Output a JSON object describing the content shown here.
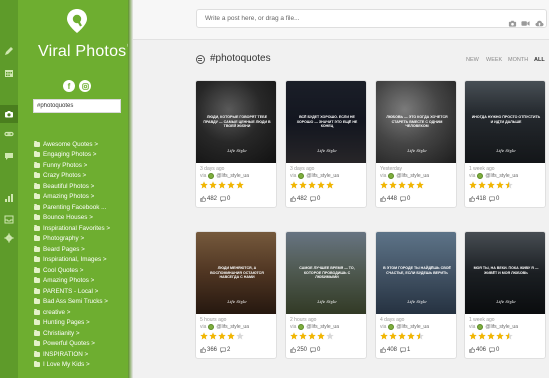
{
  "rail": {
    "icons": [
      "pencil-icon",
      "calendar-icon",
      "camera-icon",
      "link-icon",
      "comment-icon",
      "bar-chart-icon",
      "inbox-icon",
      "gear-icon"
    ]
  },
  "sidebar": {
    "title": "Viral Photos",
    "badge": "®",
    "search_value": "#photoquotes",
    "items": [
      {
        "label": "Awesome Quotes >"
      },
      {
        "label": "Engaging Photos >"
      },
      {
        "label": "Funny Photos >"
      },
      {
        "label": "Crazy Photos >"
      },
      {
        "label": "Beautiful Photos >"
      },
      {
        "label": "Amazing Photos >"
      },
      {
        "label": "Parenting Facebook ..."
      },
      {
        "label": "Bounce Houses >"
      },
      {
        "label": "Inspirational Favorites >"
      },
      {
        "label": "Photography >"
      },
      {
        "label": "Beard Pages >"
      },
      {
        "label": "Inspirational, Images >"
      },
      {
        "label": "Cool Quotes >"
      },
      {
        "label": "Amazing Photos >"
      },
      {
        "label": "PARENTS - Local >"
      },
      {
        "label": "Bad Ass Semi Trucks >"
      },
      {
        "label": "creative >"
      },
      {
        "label": "Hunting Pages >"
      },
      {
        "label": "Christianity >"
      },
      {
        "label": "Powerful Quotes >"
      },
      {
        "label": "INSPIRATION >"
      },
      {
        "label": "I Love My Kids >"
      }
    ]
  },
  "composer": {
    "placeholder": "Write a post here, or drag a file..."
  },
  "main": {
    "section_title": "#photoquotes",
    "filters": [
      "NEW",
      "WEEK",
      "MONTH",
      "ALL"
    ],
    "active_filter": "ALL",
    "cards": [
      {
        "time": "3 days ago",
        "via": "via",
        "user": "@lifs_style_ua",
        "rating": 5,
        "likes": "482",
        "comments": "0",
        "quote": "ЛЮДИ, КОТОРЫЕ ГОВОРЯТ ТЕБЕ ПРАВДУ — САМЫЕ ЦЕННЫЕ ЛЮДИ В ТВОЕЙ ЖИЗНИ",
        "signature": "Life Style"
      },
      {
        "time": "3 days ago",
        "via": "via",
        "user": "@lifs_style_ua",
        "rating": 5,
        "likes": "482",
        "comments": "0",
        "quote": "ВСЁ БУДЕТ ХОРОШО. ЕСЛИ НЕ ХОРОШО — ЗНАЧИТ ЭТО ЕЩЁ НЕ КОНЕЦ",
        "signature": "Life Style"
      },
      {
        "time": "Yesterday",
        "via": "via",
        "user": "@lifs_style_ua",
        "rating": 5,
        "likes": "448",
        "comments": "0",
        "quote": "ЛЮБОВЬ — ЭТО КОГДА ХОЧЕТСЯ СТАРЕТЬ ВМЕСТЕ С ОДНИМ ЧЕЛОВЕКОМ",
        "signature": "Life Style"
      },
      {
        "time": "1 week ago",
        "via": "via",
        "user": "@lifs_style_ua",
        "rating": 4.5,
        "likes": "418",
        "comments": "0",
        "quote": "ИНОГДА НУЖНО ПРОСТО ОТПУСТИТЬ И ИДТИ ДАЛЬШЕ",
        "signature": "Life Style"
      },
      {
        "time": "5 hours ago",
        "via": "via",
        "user": "@lifs_style_ua",
        "rating": 4,
        "likes": "366",
        "comments": "2",
        "quote": "ЛЮДИ МЕНЯЮТСЯ, А ВОСПОМИНАНИЯ ОСТАЮТСЯ НАВСЕГДА С НАМИ",
        "signature": "Life Style"
      },
      {
        "time": "2 hours ago",
        "via": "via",
        "user": "@lifs_style_ua",
        "rating": 4,
        "likes": "250",
        "comments": "0",
        "quote": "САМОЕ ЛУЧШЕЕ ВРЕМЯ — ТО, КОТОРОЕ ПРОВОДИШЬ С ЛЮБИМЫМИ",
        "signature": "Life Style"
      },
      {
        "time": "4 days ago",
        "via": "via",
        "user": "@lifs_style_ua",
        "rating": 4.5,
        "likes": "408",
        "comments": "1",
        "quote": "В ЭТОМ ГОРОДЕ ТЫ НАЙДЁШЬ СВОЁ СЧАСТЬЕ, ЕСЛИ БУДЕШЬ ВЕРИТЬ",
        "signature": "Life Style"
      },
      {
        "time": "1 week ago",
        "via": "via",
        "user": "@lifs_style_ua",
        "rating": 4.5,
        "likes": "406",
        "comments": "0",
        "quote": "МОЯ ТЫ, НА ВЕКИ. ПОКА ЖИВУ Я — ЖИВЁТ И МОЯ ЛЮБОВЬ",
        "signature": "Life Style"
      }
    ]
  },
  "colors": {
    "sidebar": "#6eae30",
    "rail": "#5e9b2a",
    "star": "#f2b600"
  }
}
